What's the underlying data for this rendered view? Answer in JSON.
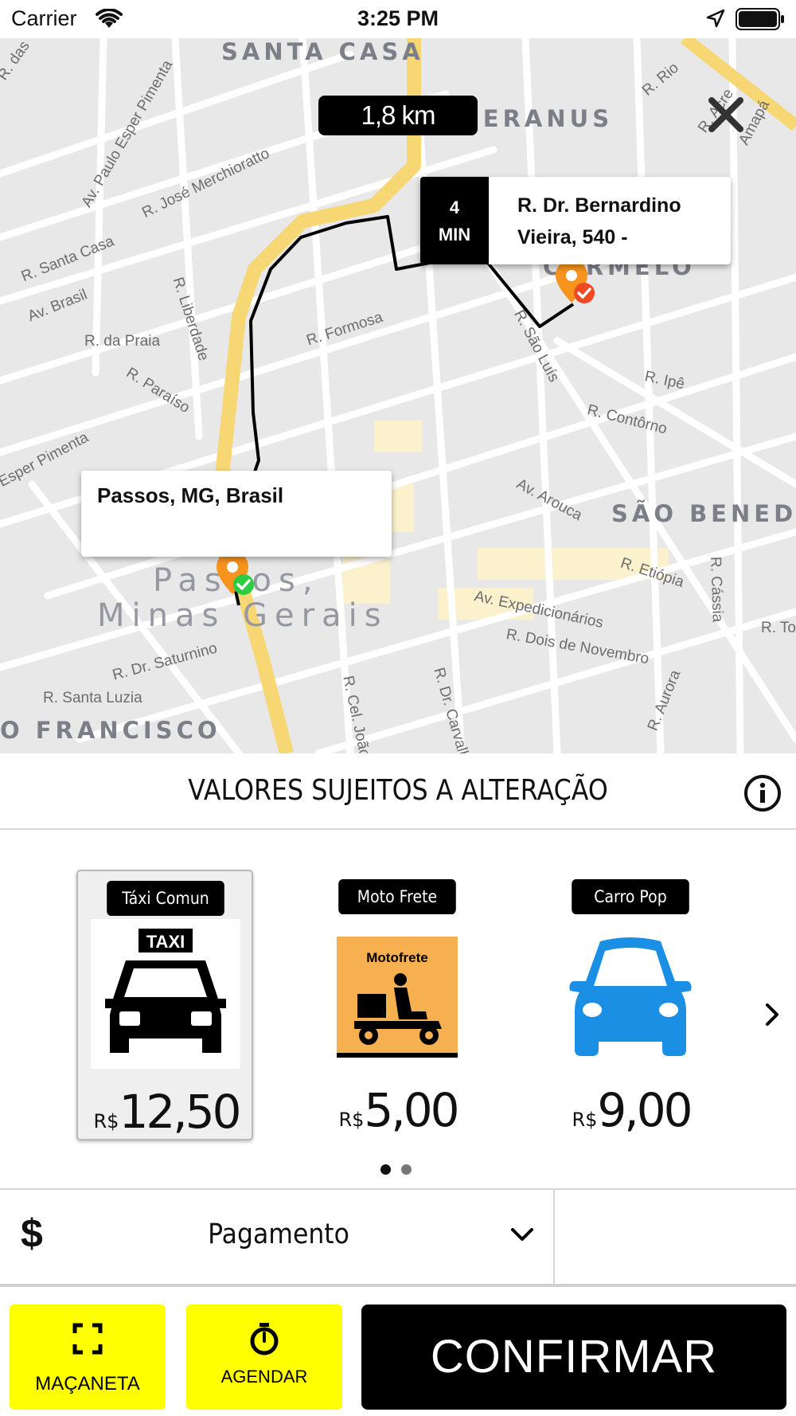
{
  "status_bar": {
    "carrier": "Carrier",
    "time": "3:25 PM"
  },
  "map": {
    "distance": "1,8 km",
    "destination": {
      "eta_value": "4",
      "eta_unit": "MIN",
      "address": "R. Dr. Bernardino Vieira, 540 -"
    },
    "origin": {
      "address": "Passos, MG, Brasil"
    },
    "districts": [
      "SANTA CASA",
      "CANJERANUS",
      "CARMELO",
      "SÃO BENEDI",
      "O FRANCISCO"
    ],
    "city_label": [
      "Passos,",
      "Minas Gerais"
    ],
    "streets": [
      "R. das",
      "Av. Paulo Esper Pimenta",
      "R. José Merchioratto",
      "R. Rio",
      "R. Acre",
      "Amapá",
      "R. Santa Casa",
      "Av. Brasil",
      "R. Liberdade",
      "R. da Praia",
      "R. Formosa",
      "R. Paraíso",
      "Esper Pimenta",
      "R. São Luís",
      "R. Ipê",
      "R. Contôrno",
      "Av. Arouca",
      "R. Etiópia",
      "R. Cássia",
      "Av. Expedicionários",
      "R. Dois de Novembro",
      "R. Dr. Saturnino",
      "R. Santa Luzia",
      "R. Cel. João de",
      "R. Dr. Carvalho",
      "R. Aurora",
      "R. To"
    ],
    "colors": {
      "route": "#000000",
      "pin": "#f7941d",
      "origin_check": "#2ecc40",
      "dest_check": "#f04a24",
      "main_road": "#f7d774"
    }
  },
  "disclaimer": {
    "text": "VALORES SUJEITOS A ALTERAÇÃO",
    "icon": "info-icon"
  },
  "vehicles": {
    "items": [
      {
        "name": "Táxi Comun",
        "currency": "R$",
        "price": "12,50",
        "icon": "taxi-icon",
        "image_text": "TAXI",
        "selected": true
      },
      {
        "name": "Moto Frete",
        "currency": "R$",
        "price": "5,00",
        "icon": "motofrete-icon",
        "image_text": "Motofrete",
        "selected": false
      },
      {
        "name": "Carro Pop",
        "currency": "R$",
        "price": "9,00",
        "icon": "car-icon",
        "selected": false
      }
    ],
    "page_indicator": {
      "current": 1,
      "total": 2
    }
  },
  "payment": {
    "symbol": "$",
    "label": "Pagamento"
  },
  "actions": {
    "macaneta_label": "MAÇANETA",
    "agendar_label": "AGENDAR",
    "confirm_label": "CONFIRMAR",
    "accent_color": "#ffff00"
  }
}
